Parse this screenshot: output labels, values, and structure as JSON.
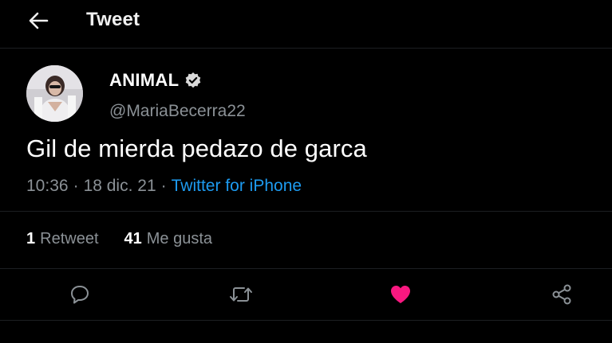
{
  "header": {
    "title": "Tweet",
    "back_icon": "arrow-left-icon"
  },
  "author": {
    "name": "ANIMAL",
    "handle": "@MariaBecerra22",
    "verified_icon": "verified-badge-icon"
  },
  "tweet": {
    "text": "Gil de mierda pedazo de garca",
    "time": "10:36",
    "separator": "·",
    "date": "18 dic. 21",
    "source": "Twitter for iPhone"
  },
  "stats": {
    "retweets_count": "1",
    "retweets_label": "Retweet",
    "likes_count": "41",
    "likes_label": "Me gusta"
  },
  "actions": {
    "reply_icon": "reply-icon",
    "retweet_icon": "retweet-icon",
    "like_icon": "heart-icon",
    "share_icon": "share-icon"
  },
  "colors": {
    "background": "#000000",
    "link": "#1d9bf0",
    "like": "#f91880",
    "muted": "#8b9196"
  }
}
